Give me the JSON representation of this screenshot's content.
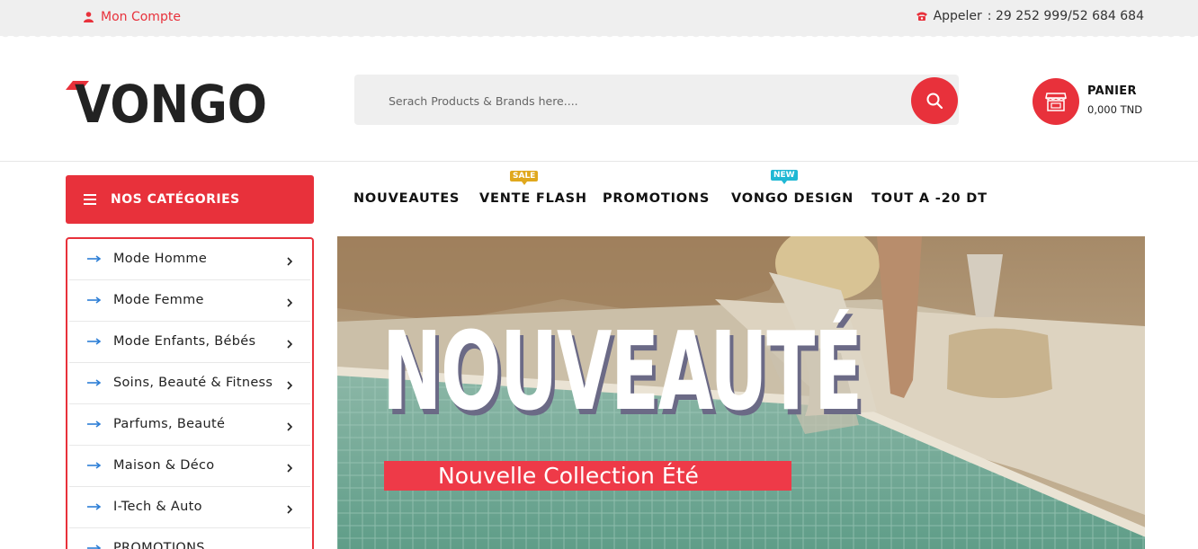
{
  "topbar": {
    "account_label": "Mon Compte",
    "phone_label": "Appeler",
    "phone_numbers": ": 29 252 999/52 684 684"
  },
  "header": {
    "logo_text": "VONGO",
    "search_placeholder": "Serach Products & Brands here....",
    "cart_label": "PANIER",
    "cart_total": "0,000 TND"
  },
  "categories": {
    "title": "NOS CATÉGORIES",
    "items": [
      {
        "label": "Mode Homme"
      },
      {
        "label": "Mode Femme"
      },
      {
        "label": "Mode Enfants, Bébés"
      },
      {
        "label": "Soins, Beauté & Fitness"
      },
      {
        "label": "Parfums, Beauté"
      },
      {
        "label": "Maison & Déco"
      },
      {
        "label": "I-Tech & Auto"
      },
      {
        "label": "PROMOTIONS"
      }
    ]
  },
  "nav": {
    "items": [
      {
        "label": "NOUVEAUTES"
      },
      {
        "label": "VENTE FLASH",
        "badge": "SALE"
      },
      {
        "label": "PROMOTIONS"
      },
      {
        "label": "VONGO DESIGN",
        "badge": "NEW"
      },
      {
        "label": "TOUT A -20 DT"
      }
    ]
  },
  "banner": {
    "title": "NOUVEAUTÉ",
    "subtitle": "Nouvelle Collection Été"
  },
  "colors": {
    "accent": "#e8313b",
    "sale_badge": "#e0a81d",
    "new_badge": "#1fb8d4"
  }
}
